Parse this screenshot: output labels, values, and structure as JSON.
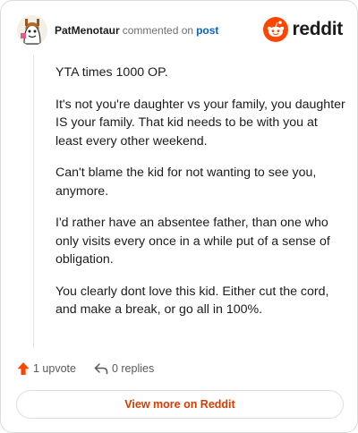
{
  "comment": {
    "username": "PatMenotaur",
    "verb": "commented on",
    "post_link": "post",
    "paragraphs": [
      "YTA times 1000 OP.",
      "It's not you're daughter vs your family, you daughter IS your family. That kid needs to be with you at least every other weekend.",
      "Can't blame the kid for not wanting to see you, anymore.",
      "I'd rather have an absentee father, than one who only visits every once in a while put of a sense of obligation.",
      "You clearly dont love this kid. Either cut the cord, and make a break, or go all in 100%."
    ]
  },
  "brand": {
    "name": "reddit",
    "icon": "reddit-logo-icon"
  },
  "actions": {
    "upvote_label": "1 upvote",
    "replies_label": "0 replies",
    "upvote_icon": "upvote-arrow-icon",
    "reply_icon": "reply-arrow-icon"
  },
  "footer": {
    "view_label": "View more on Reddit"
  },
  "colors": {
    "accent": "#ff4500",
    "link": "#0a62c9",
    "button_text": "#d93a00"
  }
}
